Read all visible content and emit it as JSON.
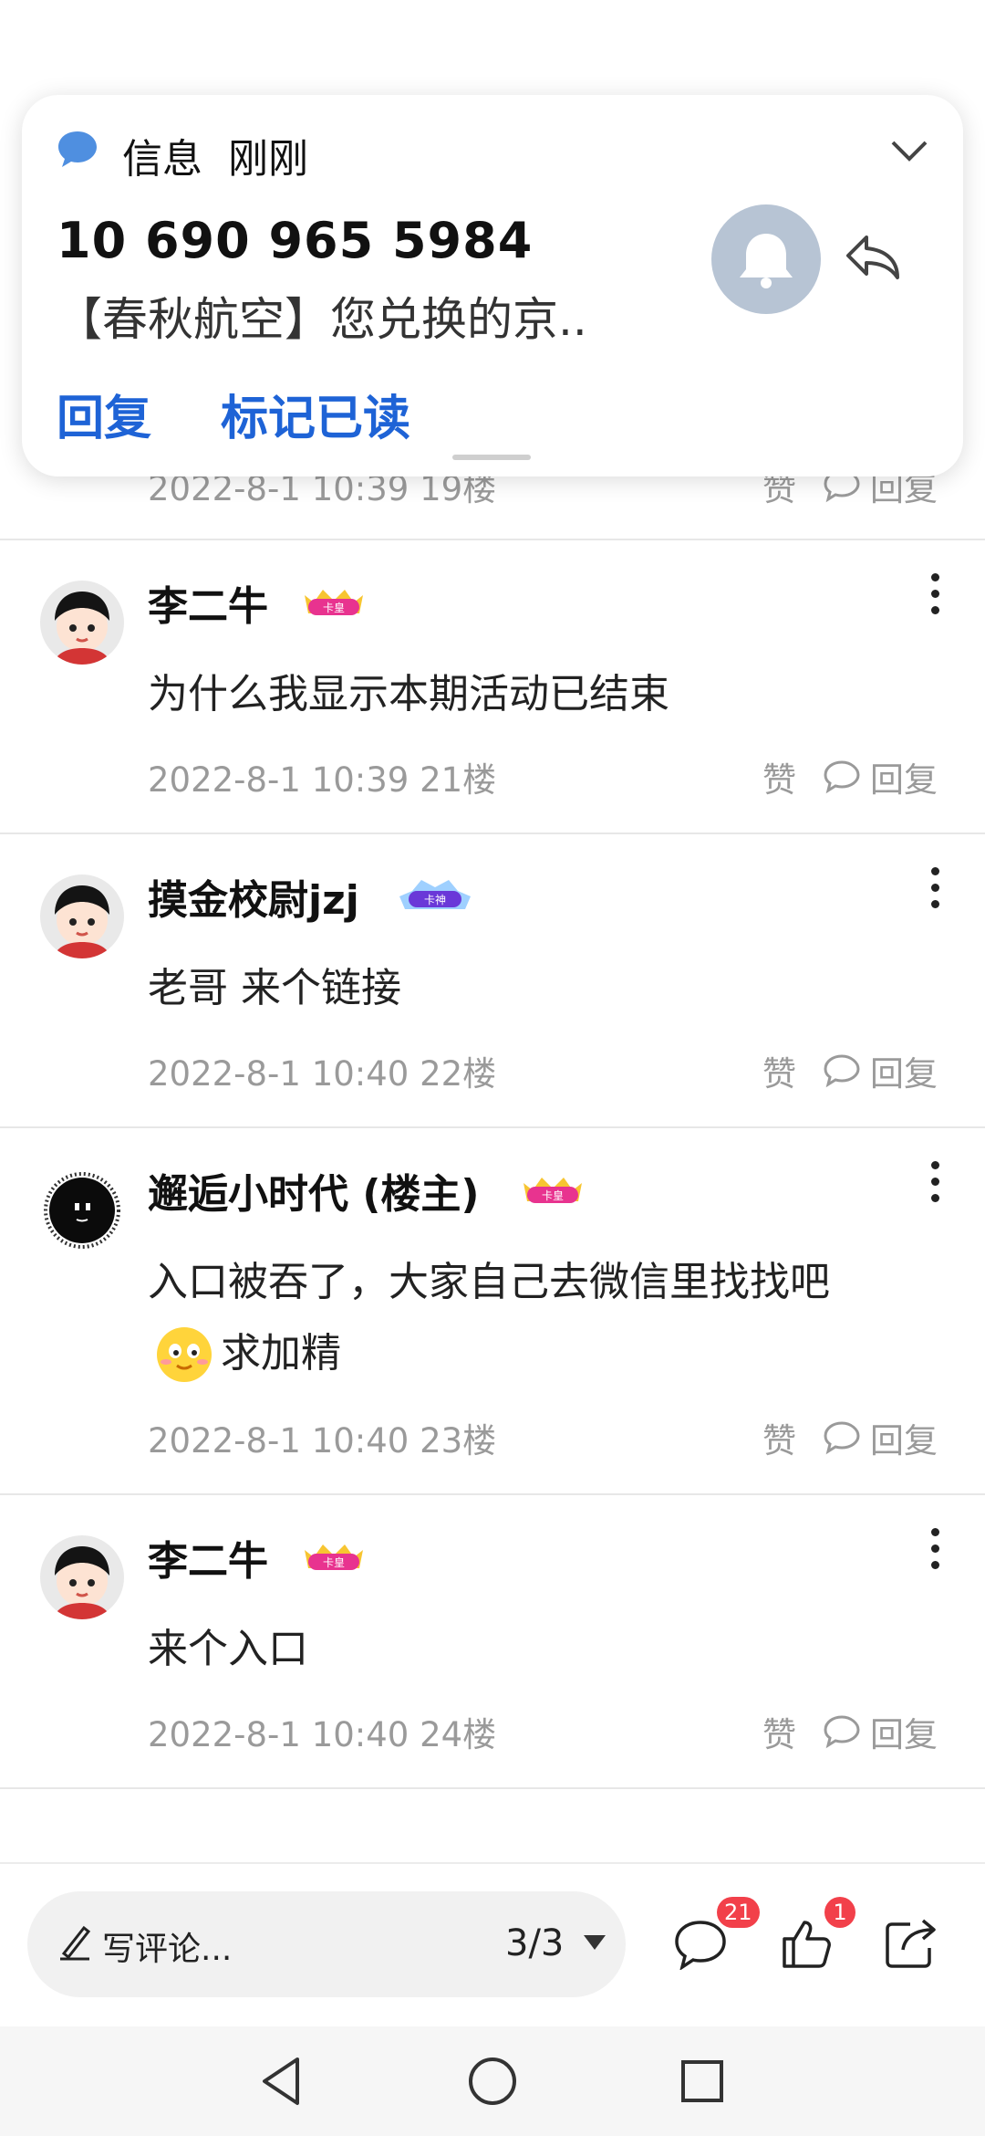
{
  "notification": {
    "app_name": "信息",
    "time": "刚刚",
    "sender": "10 690 965 5984",
    "preview": "【春秋航空】您兑换的京..",
    "actions": {
      "reply": "回复",
      "mark_read": "标记已读"
    }
  },
  "partial_comment": {
    "meta": "2022-8-1 10:39  19楼",
    "like": "赞",
    "reply": "回复"
  },
  "comments": [
    {
      "name": "李二牛",
      "badge": "卡皇",
      "text": "为什么我显示本期活动已结束",
      "meta": "2022-8-1 10:39  21楼",
      "like": "赞",
      "reply": "回复"
    },
    {
      "name": "摸金校尉jzj",
      "badge": "卡神",
      "text": "老哥 来个链接",
      "meta": "2022-8-1 10:40  22楼",
      "like": "赞",
      "reply": "回复"
    },
    {
      "name": "邂逅小时代 (楼主)",
      "badge": "卡皇",
      "text": "入口被吞了，大家自己去微信里找找吧",
      "text2": "求加精",
      "meta": "2022-8-1 10:40  23楼",
      "like": "赞",
      "reply": "回复"
    },
    {
      "name": "李二牛",
      "badge": "卡皇",
      "text": "来个入口",
      "meta": "2022-8-1 10:40  24楼",
      "like": "赞",
      "reply": "回复"
    }
  ],
  "bottom_bar": {
    "placeholder": "写评论...",
    "page": "3/3",
    "comment_count": "21",
    "like_count": "1"
  },
  "colors": {
    "accent": "#1e63d6",
    "badge_red": "#f2404a",
    "badge_pink": "#e8338f"
  }
}
